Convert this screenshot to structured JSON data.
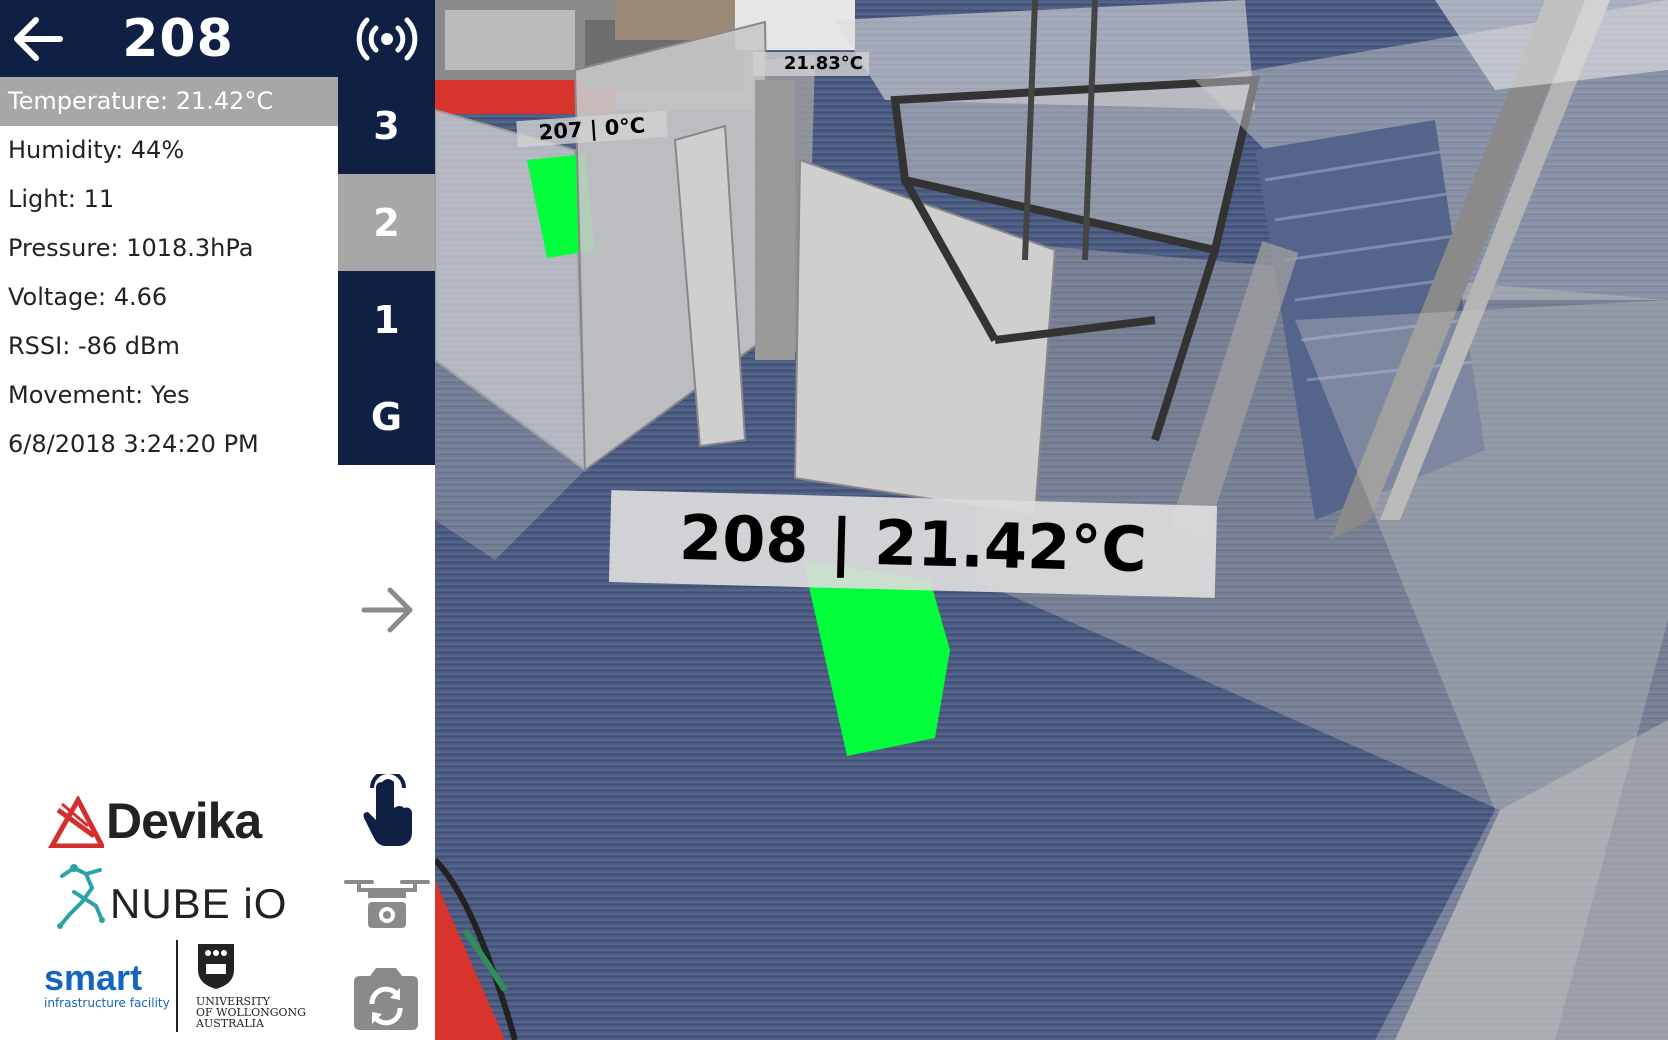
{
  "header": {
    "room_title": "208",
    "back_icon": "back-arrow-icon",
    "broadcast_icon": "broadcast-icon"
  },
  "metrics": [
    {
      "text": "Temperature: 21.42°C",
      "selected": true
    },
    {
      "text": "Humidity: 44%",
      "selected": false
    },
    {
      "text": "Light: 11",
      "selected": false
    },
    {
      "text": "Pressure: 1018.3hPa",
      "selected": false
    },
    {
      "text": "Voltage: 4.66",
      "selected": false
    },
    {
      "text": "RSSI: -86 dBm",
      "selected": false
    },
    {
      "text": "Movement: Yes",
      "selected": false
    },
    {
      "text": "6/8/2018 3:24:20 PM",
      "selected": false
    }
  ],
  "floors": [
    {
      "label": "3",
      "active": false
    },
    {
      "label": "2",
      "active": true
    },
    {
      "label": "1",
      "active": false
    },
    {
      "label": "G",
      "active": false
    }
  ],
  "controls": {
    "next_icon": "arrow-right-icon",
    "touch_icon": "pointer-hand-icon",
    "drone_icon": "drone-icon",
    "camera_icon": "camera-rotate-icon"
  },
  "logos": {
    "devika": "Devika",
    "nube": "NUBE iO",
    "smart": "smart",
    "smart_sub": "infrastructure facility",
    "uow_line1": "UNIVERSITY",
    "uow_line2": "OF WOLLONGONG",
    "uow_line3": "AUSTRALIA"
  },
  "scene": {
    "label_main": "208 | 21.42°C",
    "label_207": "207 | 0°C",
    "label_far": "21.83°C"
  },
  "colors": {
    "header_navy": "#0f2044",
    "selected_gray": "#a7a7a7",
    "sensor_green": "#00ff3a",
    "devika_red": "#d32f2f",
    "smart_blue": "#1565c0"
  }
}
